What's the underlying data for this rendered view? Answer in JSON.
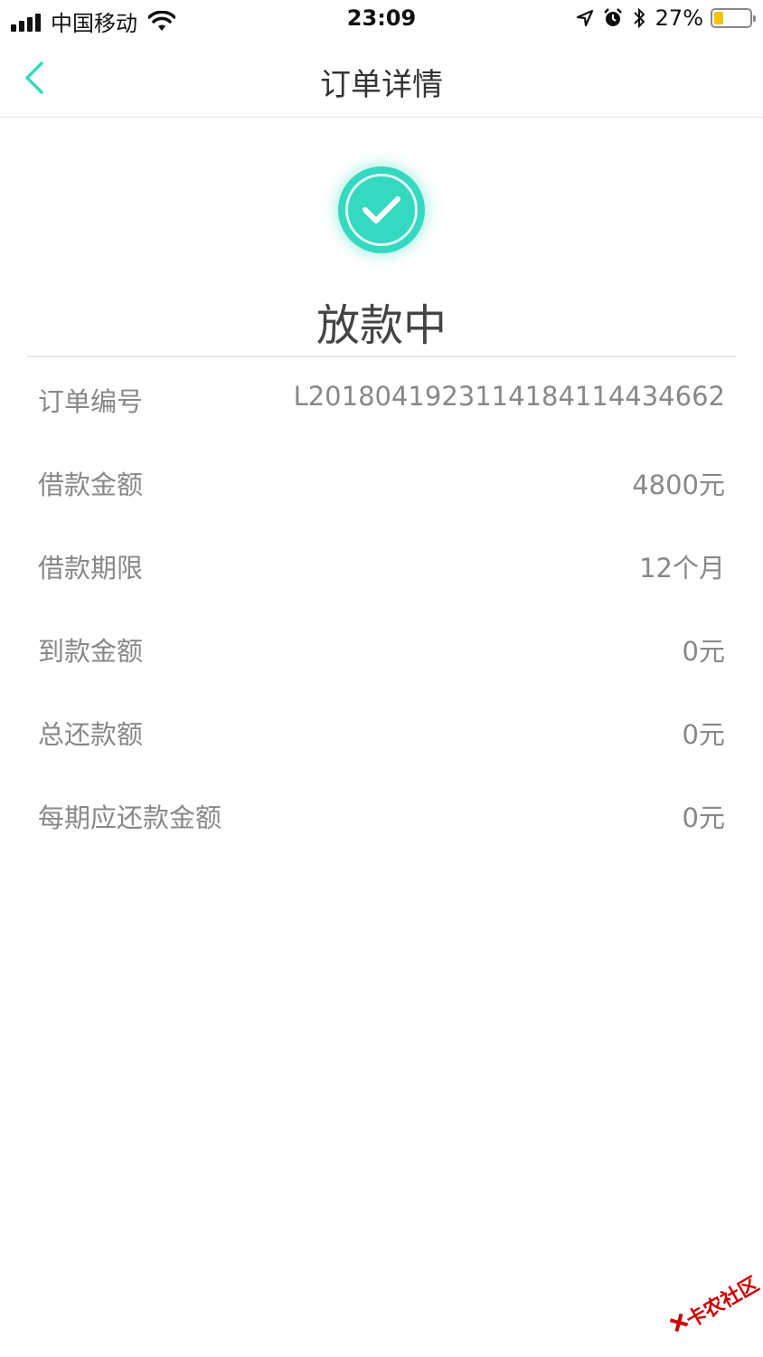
{
  "status_bar": {
    "carrier": "中国移动",
    "time": "23:09",
    "battery_percent": "27%",
    "battery_level": 0.27
  },
  "nav": {
    "title": "订单详情",
    "back_icon": "chevron-left-icon"
  },
  "order_status": {
    "icon": "check-circle-icon",
    "label": "放款中",
    "accent_color": "#35d9c0"
  },
  "details": [
    {
      "label": "订单编号",
      "value": "L20180419231141841144346​62"
    },
    {
      "label": "借款金额",
      "value": "4800元"
    },
    {
      "label": "借款期限",
      "value": "12个月"
    },
    {
      "label": "到款金额",
      "value": "0元"
    },
    {
      "label": "总还款额",
      "value": "0元"
    },
    {
      "label": "每期应还款金额",
      "value": "0元"
    }
  ],
  "watermark": {
    "text": "卡农社区"
  }
}
